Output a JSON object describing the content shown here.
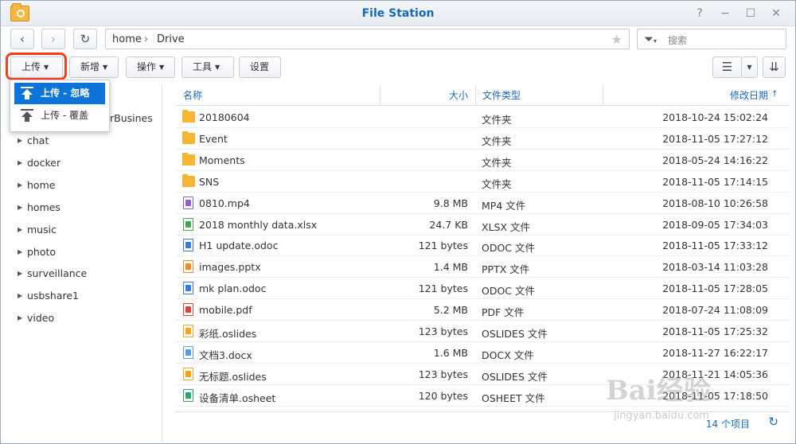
{
  "window": {
    "title": "File Station"
  },
  "nav": {
    "path": [
      "home",
      "Drive"
    ],
    "search_placeholder": "搜索"
  },
  "toolbar": {
    "upload": "上传",
    "new": "新增",
    "action": "操作",
    "tools": "工具",
    "settings": "设置"
  },
  "upload_menu": {
    "items": [
      "上传 - 忽略",
      "上传 - 覆盖"
    ]
  },
  "sidebar": {
    "peek": "rBusines",
    "items": [
      "chat",
      "docker",
      "home",
      "homes",
      "music",
      "photo",
      "surveillance",
      "usbshare1",
      "video"
    ]
  },
  "columns": {
    "name": "名称",
    "size": "大小",
    "type": "文件类型",
    "modified": "修改日期"
  },
  "files": [
    {
      "name": "20180604",
      "size": "",
      "type": "文件夹",
      "modified": "2018-10-24 15:02:24",
      "icon": "folder-icon",
      "color": "#f6b532"
    },
    {
      "name": "Event",
      "size": "",
      "type": "文件夹",
      "modified": "2018-11-05 17:27:12",
      "icon": "folder-icon",
      "color": "#f6b532"
    },
    {
      "name": "Moments",
      "size": "",
      "type": "文件夹",
      "modified": "2018-05-24 14:16:22",
      "icon": "folder-icon",
      "color": "#f6b532"
    },
    {
      "name": "SNS",
      "size": "",
      "type": "文件夹",
      "modified": "2018-11-05 17:14:15",
      "icon": "folder-icon",
      "color": "#f6b532"
    },
    {
      "name": "0810.mp4",
      "size": "9.8 MB",
      "type": "MP4 文件",
      "modified": "2018-08-10 10:26:58",
      "icon": "video-file-icon",
      "color": "#8e5fc9"
    },
    {
      "name": "2018 monthly data.xlsx",
      "size": "24.7 KB",
      "type": "XLSX 文件",
      "modified": "2018-09-05 17:34:03",
      "icon": "spreadsheet-icon",
      "color": "#4aa35a"
    },
    {
      "name": "H1 update.odoc",
      "size": "121 bytes",
      "type": "ODOC 文件",
      "modified": "2018-11-05 17:33:12",
      "icon": "document-icon",
      "color": "#3b7be0"
    },
    {
      "name": "images.pptx",
      "size": "1.4 MB",
      "type": "PPTX 文件",
      "modified": "2018-03-14 11:03:28",
      "icon": "presentation-icon",
      "color": "#f08a24"
    },
    {
      "name": "mk plan.odoc",
      "size": "121 bytes",
      "type": "ODOC 文件",
      "modified": "2018-11-05 17:28:05",
      "icon": "document-icon",
      "color": "#3b7be0"
    },
    {
      "name": "mobile.pdf",
      "size": "5.2 MB",
      "type": "PDF 文件",
      "modified": "2018-07-24 11:08:09",
      "icon": "pdf-icon",
      "color": "#e0413a"
    },
    {
      "name": "彩纸.oslides",
      "size": "123 bytes",
      "type": "OSLIDES 文件",
      "modified": "2018-11-05 17:25:32",
      "icon": "slides-icon",
      "color": "#f2a31e"
    },
    {
      "name": "文档3.docx",
      "size": "1.6 MB",
      "type": "DOCX 文件",
      "modified": "2018-11-27 16:22:17",
      "icon": "word-icon",
      "color": "#5a9be6"
    },
    {
      "name": "无标题.oslides",
      "size": "123 bytes",
      "type": "OSLIDES 文件",
      "modified": "2018-11-21 14:05:36",
      "icon": "slides-icon",
      "color": "#f2a31e"
    },
    {
      "name": "设备清单.osheet",
      "size": "120 bytes",
      "type": "OSHEET 文件",
      "modified": "2018-11-05 17:18:50",
      "icon": "sheet-icon",
      "color": "#2ea56a"
    }
  ],
  "footer": {
    "count": "14 个项目"
  },
  "watermark": {
    "text": "Bai经验",
    "url": "jingyan.baidu.com"
  }
}
